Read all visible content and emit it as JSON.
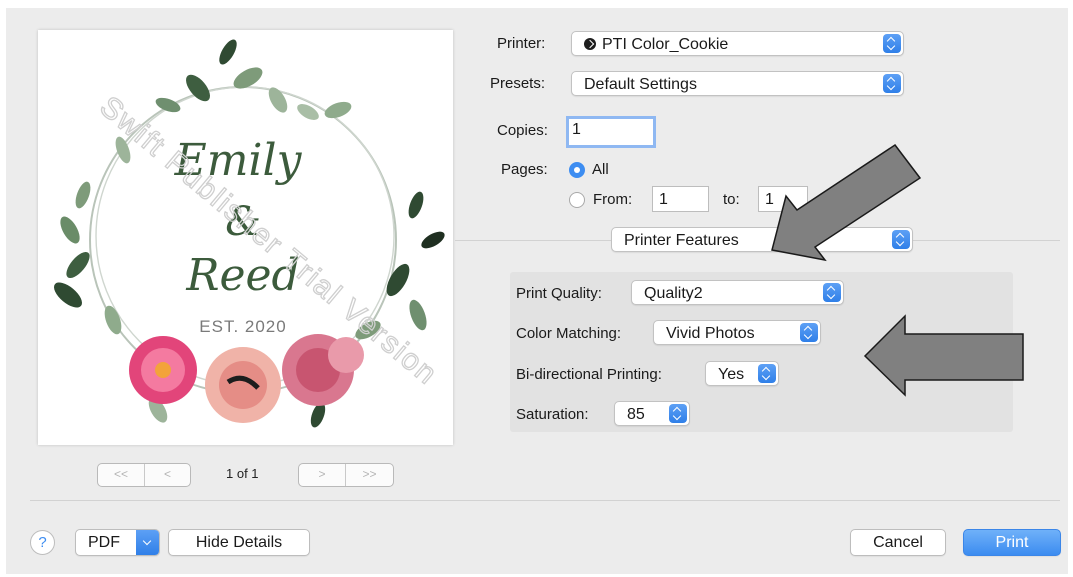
{
  "preview": {
    "names": [
      "Emily",
      "&",
      "Reed"
    ],
    "est": "EST. 2020",
    "watermark": "Swift Publisher Trial Version"
  },
  "pager": {
    "first": "<<",
    "prev": "<",
    "next": ">",
    "last": ">>",
    "page_count": "1 of 1"
  },
  "printer": {
    "label": "Printer:",
    "value": "PTI Color_Cookie"
  },
  "presets": {
    "label": "Presets:",
    "value": "Default Settings"
  },
  "copies": {
    "label": "Copies:",
    "value": "1"
  },
  "pages": {
    "label": "Pages:",
    "all_label": "All",
    "from_label": "From:",
    "from_value": "1",
    "to_label": "to:",
    "to_value": "1",
    "selected": "All"
  },
  "section_popup": {
    "value": "Printer Features"
  },
  "features": {
    "print_quality": {
      "label": "Print Quality:",
      "value": "Quality2"
    },
    "color_matching": {
      "label": "Color Matching:",
      "value": "Vivid Photos"
    },
    "bidirectional": {
      "label": "Bi-directional Printing:",
      "value": "Yes"
    },
    "saturation": {
      "label": "Saturation:",
      "value": "85"
    }
  },
  "bottom": {
    "help": "?",
    "pdf": "PDF",
    "hide_details": "Hide Details",
    "cancel": "Cancel",
    "print": "Print"
  },
  "icons": {
    "printer": "printer-status-icon",
    "help": "help-icon",
    "stepper": "popup-stepper-icon",
    "arrow": "annotation-arrow-icon"
  },
  "colors": {
    "accent": "#3d8df1",
    "dialog_bg": "#ececec",
    "arrow_fill": "#808080"
  }
}
